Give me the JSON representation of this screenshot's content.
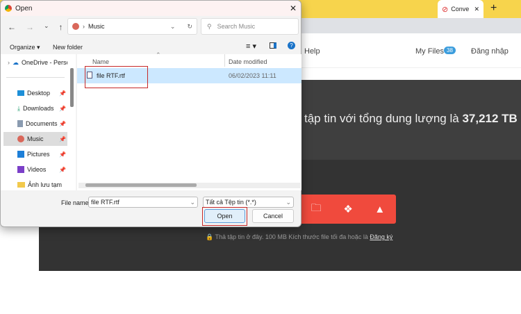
{
  "browser": {
    "tab_title": "Conve",
    "new_tab": "+",
    "close": "✕"
  },
  "site": {
    "help": "Help",
    "my_files": "My Files",
    "my_files_count": "38",
    "login": "Đăng nhập",
    "hero_text": "tập tin với tổng dung lượng là ",
    "hero_bold": "37,212 TB",
    "drop_text": "Thả tập tin ở đây. 100 MB Kích thước file tối đa hoặc là ",
    "signup": "Đăng ký"
  },
  "dialog": {
    "title": "Open",
    "path": "Music",
    "search_placeholder": "Search Music",
    "organize": "Organize ▾",
    "new_folder": "New folder",
    "columns": {
      "name": "Name",
      "date": "Date modified"
    },
    "files": [
      {
        "name": "file RTF.rtf",
        "date": "06/02/2023 11:11"
      }
    ],
    "sidebar": [
      {
        "label": "OneDrive - Perso"
      },
      {
        "label": "Desktop"
      },
      {
        "label": "Downloads"
      },
      {
        "label": "Documents"
      },
      {
        "label": "Music"
      },
      {
        "label": "Pictures"
      },
      {
        "label": "Videos"
      },
      {
        "label": "Ảnh lưu tạm"
      }
    ],
    "file_name_label": "File name:",
    "file_name_value": "file RTF.rtf",
    "file_type": "Tất cả Tệp tin (*.*)",
    "open": "Open",
    "cancel": "Cancel"
  },
  "colors": {
    "highlight": "#cce8ff",
    "accent_red": "#f04a3d",
    "badge": "#3b9ddd"
  }
}
